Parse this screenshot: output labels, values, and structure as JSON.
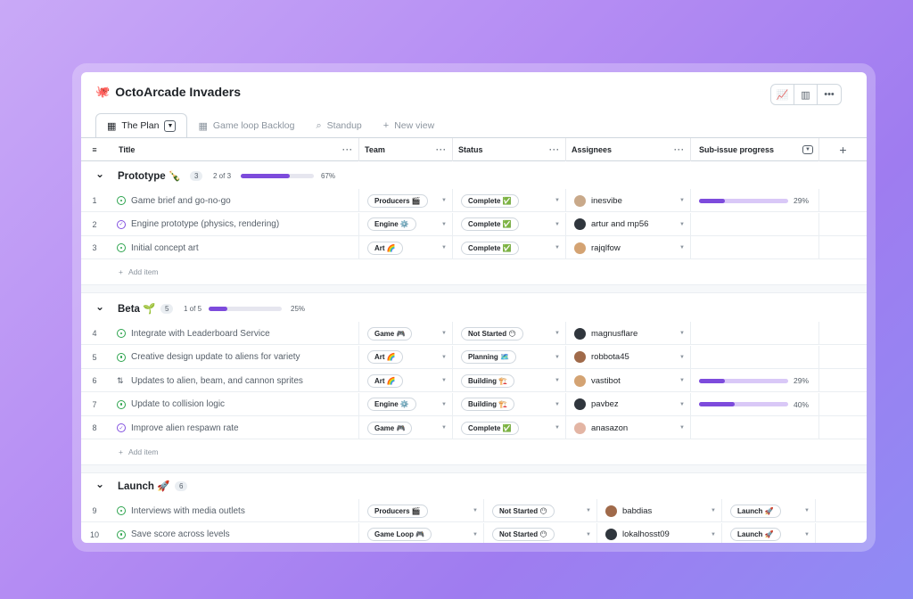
{
  "app": {
    "title": "OctoArcade Invaders",
    "logo_icon": "octocat-icon"
  },
  "toolbar": {
    "icons": [
      "chart-icon",
      "sidebar-panel-icon",
      "more-icon"
    ]
  },
  "tabs": [
    {
      "label": "The Plan",
      "icon": "table-icon",
      "active": true
    },
    {
      "label": "Game loop Backlog",
      "icon": "table-icon",
      "active": false
    },
    {
      "label": "Standup",
      "icon": "search-icon",
      "active": false
    },
    {
      "label": "New view",
      "icon": "plus-icon",
      "active": false
    }
  ],
  "columns": {
    "title": "Title",
    "team": "Team",
    "status": "Status",
    "assignees": "Assignees",
    "progress": "Sub-issue progress"
  },
  "add_item_label": "Add item",
  "groups": [
    {
      "name": "Prototype 🍾",
      "count": "3",
      "of": "2 of 3",
      "progress": 0.67,
      "percent": "67%",
      "rows": [
        {
          "num": "1",
          "icon": "open",
          "title": "Game brief and go-no-go",
          "team": "Producers 🎬",
          "status": "Complete ✅",
          "assignee": "inesvibe",
          "avatar": "a",
          "sub": 0.29,
          "sub_pct": "29%"
        },
        {
          "num": "2",
          "icon": "done",
          "title": "Engine prototype (physics, rendering)",
          "team": "Engine ⚙️",
          "status": "Complete ✅",
          "assignee": "artur and mp56",
          "avatar": "b",
          "sub": null,
          "sub_pct": ""
        },
        {
          "num": "3",
          "icon": "open",
          "title": "Initial concept art",
          "team": "Art 🌈",
          "status": "Complete ✅",
          "assignee": "rajqlfow",
          "avatar": "c",
          "sub": null,
          "sub_pct": ""
        }
      ]
    },
    {
      "name": "Beta 🌱",
      "count": "5",
      "of": "1 of 5",
      "progress": 0.25,
      "percent": "25%",
      "rows": [
        {
          "num": "4",
          "icon": "open",
          "title": "Integrate with Leaderboard Service",
          "team": "Game 🎮",
          "status": "Not Started 😶",
          "assignee": "magnusflare",
          "avatar": "b",
          "sub": null,
          "sub_pct": ""
        },
        {
          "num": "5",
          "icon": "open",
          "title": "Creative design update to aliens for variety",
          "team": "Art 🌈",
          "status": "Planning 🗺️",
          "assignee": "robbota45",
          "avatar": "d",
          "sub": null,
          "sub_pct": ""
        },
        {
          "num": "6",
          "icon": "pr",
          "title": "Updates to alien, beam, and cannon sprites",
          "team": "Art 🌈",
          "status": "Building 🏗️",
          "assignee": "vastibot",
          "avatar": "c",
          "sub": 0.29,
          "sub_pct": "29%"
        },
        {
          "num": "7",
          "icon": "open",
          "title": "Update to collision logic",
          "team": "Engine ⚙️",
          "status": "Building 🏗️",
          "assignee": "pavbez",
          "avatar": "b",
          "sub": 0.4,
          "sub_pct": "40%"
        },
        {
          "num": "8",
          "icon": "done",
          "title": "Improve alien respawn rate",
          "team": "Game 🎮",
          "status": "Complete ✅",
          "assignee": "anasazon",
          "avatar": "e",
          "sub": null,
          "sub_pct": ""
        }
      ]
    },
    {
      "name": "Launch 🚀",
      "count": "6",
      "rows": [
        {
          "num": "9",
          "icon": "open",
          "title": "Interviews with media outlets",
          "team": "Producers 🎬",
          "status": "Not Started 😶",
          "assignee": "babdias",
          "avatar": "d",
          "milestone": "Launch 🚀"
        },
        {
          "num": "10",
          "icon": "open",
          "title": "Save score across levels",
          "team": "Game Loop 🎮",
          "status": "Not Started 😶",
          "assignee": "lokalhosst09",
          "avatar": "b",
          "milestone": "Launch 🚀"
        }
      ]
    }
  ]
}
